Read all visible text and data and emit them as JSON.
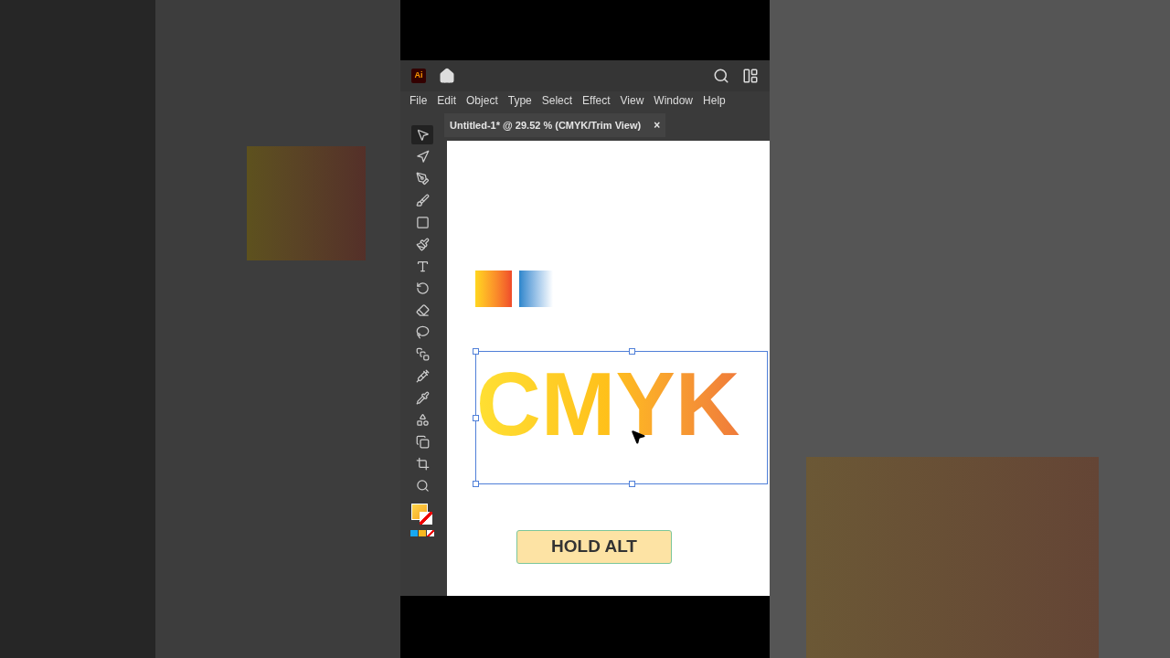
{
  "app_bar": {
    "logo": "Ai"
  },
  "menu": [
    "File",
    "Edit",
    "Object",
    "Type",
    "Select",
    "Effect",
    "View",
    "Window",
    "Help"
  ],
  "document_tab": {
    "title": "Untitled-1* @ 29.52 % (CMYK/Trim View)",
    "close": "×"
  },
  "tools": [
    {
      "selected": true
    },
    {
      "selected": false
    },
    {
      "selected": false
    },
    {
      "selected": false
    },
    {
      "selected": false
    },
    {
      "selected": false
    },
    {
      "selected": false
    },
    {
      "selected": false
    },
    {
      "selected": false
    },
    {
      "selected": false
    },
    {
      "selected": false
    },
    {
      "selected": false
    },
    {
      "selected": false
    },
    {
      "selected": false
    },
    {
      "selected": false
    },
    {
      "selected": false
    },
    {
      "selected": false
    }
  ],
  "artboard": {
    "headline": "CMYK"
  },
  "caption": "HOLD ALT"
}
